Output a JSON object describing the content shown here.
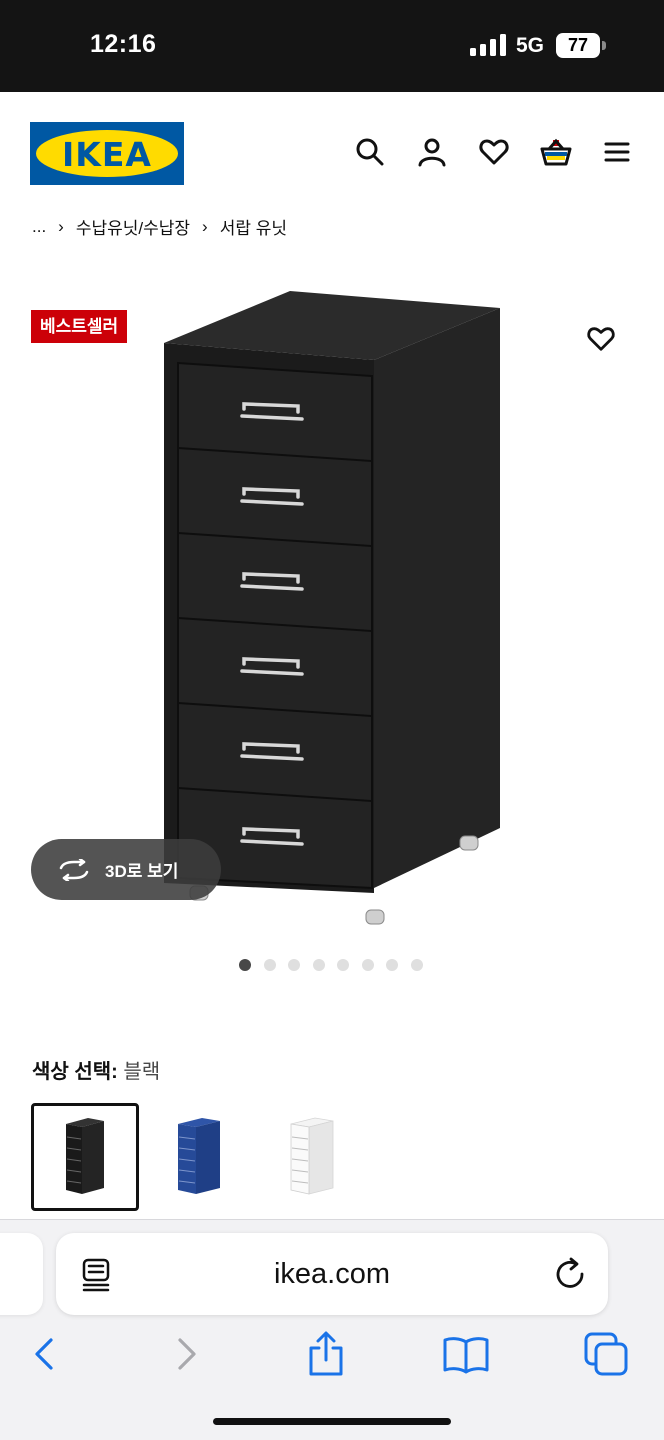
{
  "status_bar": {
    "time": "12:16",
    "network": "5G",
    "battery": "77"
  },
  "header": {
    "logo_text": "IKEA",
    "brand_colors": {
      "blue": "#0058a3",
      "yellow": "#ffdb00"
    },
    "icons": [
      "search-icon",
      "account-icon",
      "heart-icon",
      "basket-icon",
      "menu-icon"
    ]
  },
  "breadcrumb": {
    "ellipsis": "...",
    "items": [
      "수납유닛/수납장",
      "서랍 유닛"
    ]
  },
  "product": {
    "badge": "베스트셀러",
    "badge_color": "#cc0008",
    "view_3d_label": "3D로 보기",
    "image_count": 8,
    "active_image": 1
  },
  "color_selection": {
    "label": "색상 선택:",
    "selected_value": "블랙",
    "options": [
      "블랙",
      "블루",
      "화이트"
    ]
  },
  "browser": {
    "url": "ikea.com",
    "accent_color": "#1a73e8"
  }
}
